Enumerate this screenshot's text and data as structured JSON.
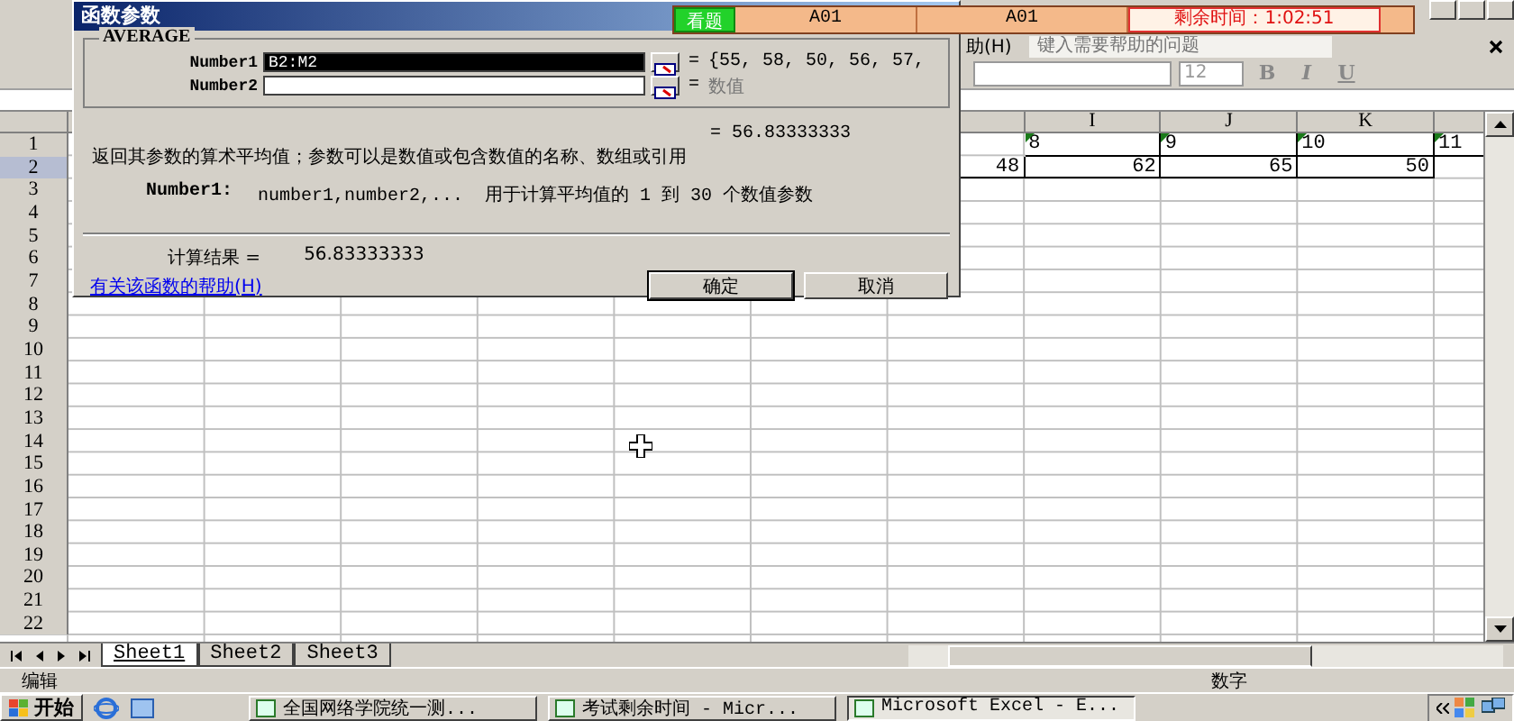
{
  "excel": {
    "menu_item": "助(H)",
    "help_search": {
      "placeholder": "键入需要帮助的问题"
    },
    "font_size": "12",
    "format_buttons": [
      "B",
      "I",
      "U"
    ]
  },
  "exam_bar": {
    "view_button": "看题",
    "fields": [
      "A01",
      "A01"
    ],
    "time_left": "剩余时间：1:02:51"
  },
  "sheet": {
    "column_headers": [
      "I",
      "J",
      "K"
    ],
    "rows": [
      {
        "number": "1",
        "selected": false,
        "cells": [
          {
            "text": "8",
            "kind": "text"
          },
          {
            "text": "9",
            "kind": "text"
          },
          {
            "text": "10",
            "kind": "text"
          },
          {
            "text": "11",
            "kind": "text"
          }
        ]
      },
      {
        "number": "2",
        "selected": true,
        "cells": [
          {
            "text": "48",
            "kind": "number"
          },
          {
            "text": "62",
            "kind": "number"
          },
          {
            "text": "65",
            "kind": "number"
          },
          {
            "text": "50",
            "kind": "number"
          }
        ]
      },
      {
        "number": "3",
        "selected": false,
        "cells": []
      },
      {
        "number": "4",
        "selected": false,
        "cells": []
      },
      {
        "number": "5",
        "selected": false,
        "cells": []
      },
      {
        "number": "6",
        "selected": false,
        "cells": []
      },
      {
        "number": "7",
        "selected": false,
        "cells": []
      },
      {
        "number": "8",
        "selected": false,
        "cells": []
      },
      {
        "number": "9",
        "selected": false,
        "cells": []
      },
      {
        "number": "10",
        "selected": false,
        "cells": []
      },
      {
        "number": "11",
        "selected": false,
        "cells": []
      },
      {
        "number": "12",
        "selected": false,
        "cells": []
      },
      {
        "number": "13",
        "selected": false,
        "cells": []
      },
      {
        "number": "14",
        "selected": false,
        "cells": []
      },
      {
        "number": "15",
        "selected": false,
        "cells": []
      },
      {
        "number": "16",
        "selected": false,
        "cells": []
      },
      {
        "number": "17",
        "selected": false,
        "cells": []
      },
      {
        "number": "18",
        "selected": false,
        "cells": []
      },
      {
        "number": "19",
        "selected": false,
        "cells": []
      },
      {
        "number": "20",
        "selected": false,
        "cells": []
      },
      {
        "number": "21",
        "selected": false,
        "cells": []
      },
      {
        "number": "22",
        "selected": false,
        "cells": []
      }
    ],
    "tabs": [
      {
        "label": "Sheet1",
        "selected": true
      },
      {
        "label": "Sheet2",
        "selected": false
      },
      {
        "label": "Sheet3",
        "selected": false
      }
    ]
  },
  "status_bar": {
    "mode": "编辑",
    "indicator": "数字"
  },
  "dialog": {
    "title": "函数参数",
    "function_name": "AVERAGE",
    "arguments": [
      {
        "label": "Number1",
        "value": "B2:M2",
        "selected": true,
        "equals": "=",
        "result": "{55, 58, 50, 56, 57,",
        "dimmed": false
      },
      {
        "label": "Number2",
        "selected": false,
        "equals": "=",
        "result": "数值",
        "dimmed": true
      }
    ],
    "formula_result": "= 56.83333333",
    "description": "返回其参数的算术平均值；参数可以是数值或包含数值的名称、数组或引用",
    "argument_help_label": "Number1:",
    "argument_help": "number1,number2,...  用于计算平均值的 1 到 30 个数值参数",
    "result_label": "计算结果 =",
    "result_value": "56.83333333",
    "help_link": "有关该函数的帮助(H)",
    "buttons": [
      "确定",
      "取消"
    ]
  },
  "taskbar": {
    "start": "开始",
    "windows": [
      {
        "label": "全国网络学院统一测...",
        "selected": false
      },
      {
        "label": "考试剩余时间 - Micr...",
        "selected": false
      },
      {
        "label": "Microsoft Excel - E...",
        "selected": true
      }
    ]
  }
}
